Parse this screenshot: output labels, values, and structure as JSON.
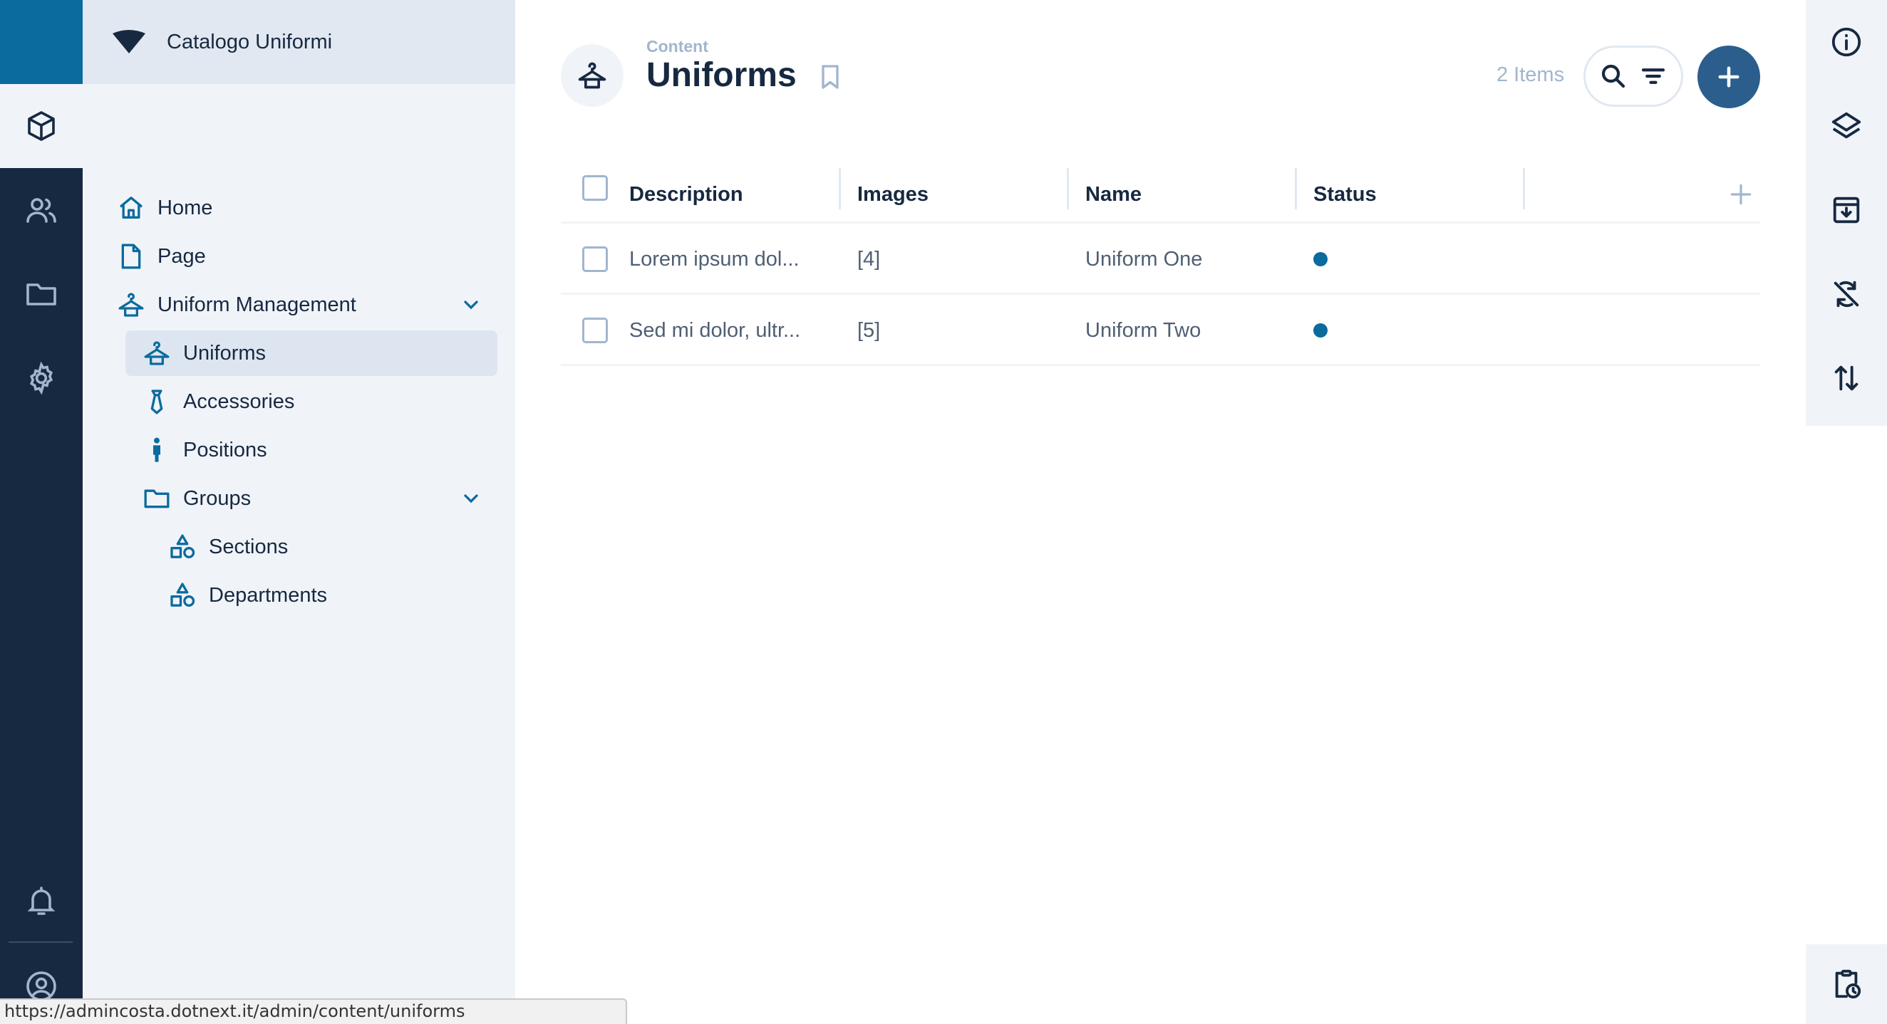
{
  "project": {
    "name": "Catalogo Uniformi"
  },
  "nav": {
    "items": [
      {
        "label": "Home"
      },
      {
        "label": "Page"
      },
      {
        "label": "Uniform Management"
      },
      {
        "label": "Uniforms"
      },
      {
        "label": "Accessories"
      },
      {
        "label": "Positions"
      },
      {
        "label": "Groups"
      },
      {
        "label": "Sections"
      },
      {
        "label": "Departments"
      }
    ]
  },
  "header": {
    "breadcrumb": "Content",
    "title": "Uniforms",
    "item_count": "2 Items"
  },
  "table": {
    "columns": [
      "Description",
      "Images",
      "Name",
      "Status"
    ],
    "rows": [
      {
        "description": "Lorem ipsum dol...",
        "images": "[4]",
        "name": "Uniform One"
      },
      {
        "description": "Sed mi dolor, ultr...",
        "images": "[5]",
        "name": "Uniform Two"
      }
    ]
  },
  "colors": {
    "accent": "#0c6b9e",
    "dark": "#172940",
    "primary_button": "#2b5e8c"
  },
  "status_url": "https://admincosta.dotnext.it/admin/content/uniforms"
}
